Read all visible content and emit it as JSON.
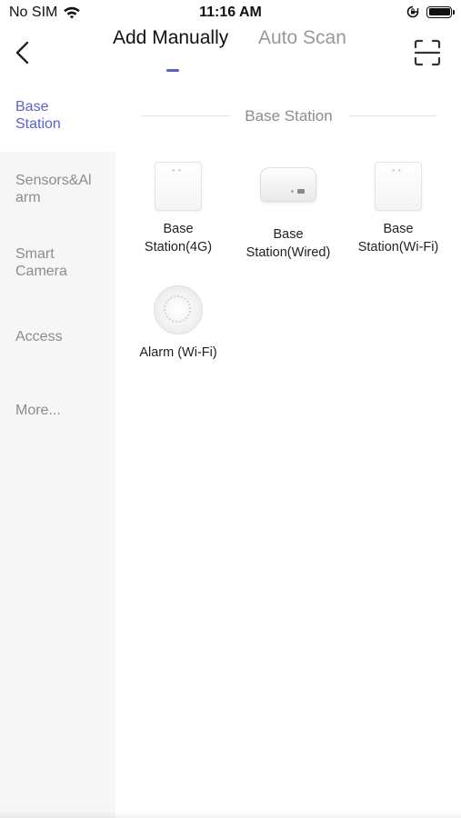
{
  "status_bar": {
    "carrier": "No SIM",
    "time": "11:16 AM",
    "icons": [
      "wifi-icon",
      "screen-lock-rotation-icon",
      "battery-icon"
    ]
  },
  "nav": {
    "back_icon": "chevron-left-icon",
    "tabs": [
      {
        "label": "Add Manually",
        "active": true
      },
      {
        "label": "Auto Scan",
        "active": false
      }
    ],
    "scan_icon": "scan-frame-icon",
    "accent_color": "#5b63c9"
  },
  "sidebar": {
    "items": [
      {
        "label": "Base\nStation",
        "selected": true
      },
      {
        "label": "Sensors&Al\narm",
        "selected": false
      },
      {
        "label": "Smart\nCamera",
        "selected": false
      },
      {
        "label": "Access",
        "selected": false
      },
      {
        "label": "More...",
        "selected": false
      }
    ]
  },
  "main": {
    "section_title": "Base Station",
    "devices": [
      {
        "label": "Base\nStation(4G)",
        "icon": "base-station-box-icon"
      },
      {
        "label": "Base\nStation(Wired)",
        "icon": "base-station-wired-icon"
      },
      {
        "label": "Base\nStation(Wi-Fi)",
        "icon": "base-station-box-icon"
      },
      {
        "label": "Alarm (Wi-Fi)",
        "icon": "round-alarm-icon"
      }
    ]
  }
}
